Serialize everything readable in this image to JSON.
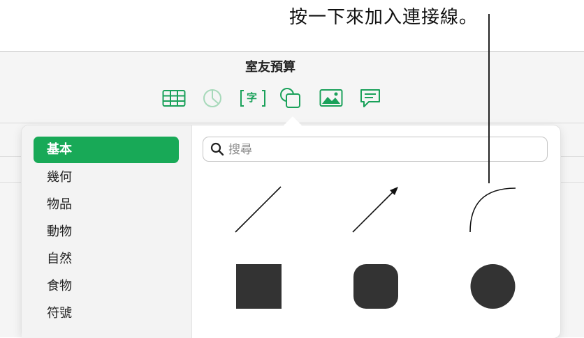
{
  "callout": {
    "text": "按一下來加入連接線。"
  },
  "window": {
    "title": "室友預算"
  },
  "toolbar": {
    "items": [
      {
        "name": "table",
        "icon": "table-icon"
      },
      {
        "name": "chart",
        "icon": "chart-icon"
      },
      {
        "name": "text",
        "icon": "text-box-icon",
        "glyph": "字"
      },
      {
        "name": "shape",
        "icon": "shape-icon"
      },
      {
        "name": "media",
        "icon": "image-icon"
      },
      {
        "name": "comment",
        "icon": "comment-icon"
      }
    ]
  },
  "shape_browser": {
    "categories": [
      {
        "label": "基本",
        "selected": true
      },
      {
        "label": "幾何",
        "selected": false
      },
      {
        "label": "物品",
        "selected": false
      },
      {
        "label": "動物",
        "selected": false
      },
      {
        "label": "自然",
        "selected": false
      },
      {
        "label": "食物",
        "selected": false
      },
      {
        "label": "符號",
        "selected": false
      }
    ],
    "search": {
      "placeholder": "搜尋",
      "value": ""
    },
    "shapes": [
      {
        "name": "line",
        "icon": "line-shape-icon"
      },
      {
        "name": "arrow",
        "icon": "arrow-line-shape-icon"
      },
      {
        "name": "curve",
        "icon": "curved-connection-line-icon"
      },
      {
        "name": "square",
        "icon": "square-shape-icon"
      },
      {
        "name": "rounded-square",
        "icon": "rounded-square-shape-icon"
      },
      {
        "name": "circle",
        "icon": "circle-shape-icon"
      }
    ]
  },
  "colors": {
    "accent": "#18a957",
    "toolbar_icon": "#1aa15a",
    "toolbar_icon_disabled": "#a7d9ba",
    "shape_fill": "#333333"
  }
}
